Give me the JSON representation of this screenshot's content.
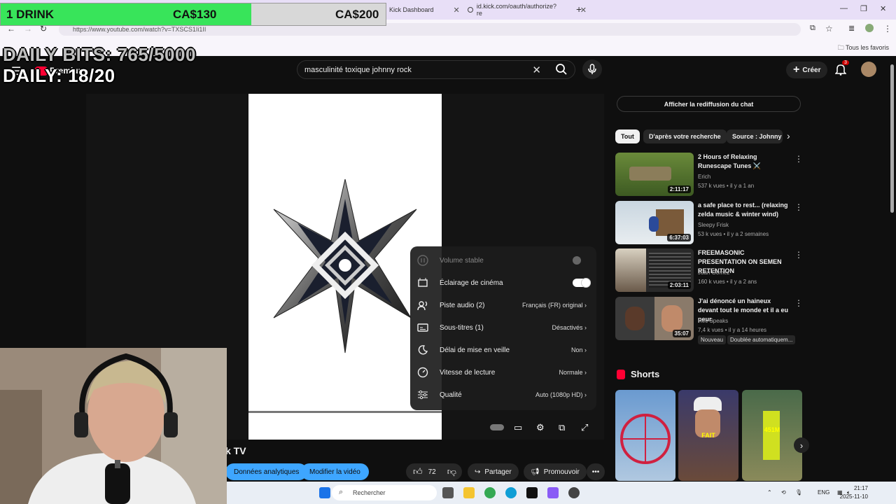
{
  "browser": {
    "tabs": [
      {
        "label": "Kick Dashboard"
      },
      {
        "label": "id.kick.com/oauth/authorize?re"
      }
    ],
    "url": "https://www.youtube.com/watch?v=TXSCS1Ii1II",
    "bookmarks_all": "Tous les favoris"
  },
  "overlay": {
    "drink_label": "1 DRINK",
    "current_amount": "CA$130",
    "goal_amount": "CA$200",
    "goal_progress": 0.65,
    "daily_bits": "DAILY BITS: 765/5000",
    "daily": "DAILY: 18/20"
  },
  "header": {
    "search_query": "masculinité toxique johnny rock",
    "create_label": "Créer",
    "notif_count": "3",
    "premium": "Premium"
  },
  "settings_menu": {
    "items": [
      {
        "label": "Volume stable",
        "value": "",
        "icon": "stable-volume-icon"
      },
      {
        "label": "Éclairage de cinéma",
        "value": "",
        "icon": "ambient-mode-icon"
      },
      {
        "label": "Piste audio (2)",
        "value": "Français (FR) original",
        "icon": "audio-track-icon"
      },
      {
        "label": "Sous-titres (1)",
        "value": "Désactivés",
        "icon": "subtitles-icon"
      },
      {
        "label": "Délai de mise en veille",
        "value": "Non",
        "icon": "sleep-timer-icon"
      },
      {
        "label": "Vitesse de lecture",
        "value": "Normale",
        "icon": "playback-speed-icon"
      },
      {
        "label": "Qualité",
        "value": "Auto (1080p HD)",
        "icon": "quality-icon"
      }
    ]
  },
  "video": {
    "title": "k TV",
    "analytics_label": "Données analytiques",
    "edit_label": "Modifier la vidéo",
    "likes": "72",
    "share_label": "Partager",
    "promote_label": "Promouvoir"
  },
  "sidebar": {
    "chat_replay": "Afficher la rediffusion du chat",
    "chips": [
      "Tout",
      "D'après votre recherche",
      "Source : Johnny"
    ],
    "recommendations": [
      {
        "title": "2 Hours of Relaxing Runescape Tunes ⚔️",
        "channel": "Erich",
        "meta": "537 k vues • il y a 1 an",
        "duration": "2:11:17"
      },
      {
        "title": "a safe place to rest... (relaxing zelda music & winter wind)",
        "channel": "Sleepy Frisk",
        "meta": "53 k vues • il y a 2 semaines",
        "duration": "6:37:03"
      },
      {
        "title": "FREEMASONIC PRESENTATION ON SEMEN RETENTION",
        "channel": "Juan Gomez",
        "meta": "160 k vues • il y a 2 ans",
        "duration": "2:03:11"
      },
      {
        "title": "J'ai dénoncé un haineux devant tout le monde et il a eu peur.",
        "channel": "Hec Speaks",
        "meta": "7,4 k vues • il y a 14 heures",
        "duration": "35:07",
        "tags": [
          "Nouveau",
          "Doublée automatiquem..."
        ]
      }
    ],
    "shorts_title": "Shorts",
    "shorts": [
      {
        "label": ""
      },
      {
        "label": "FAIT"
      },
      {
        "label": "451M"
      }
    ]
  },
  "taskbar": {
    "search": "Rechercher",
    "lang": "ENG",
    "time": "21:17",
    "date": "2025-11-10"
  }
}
